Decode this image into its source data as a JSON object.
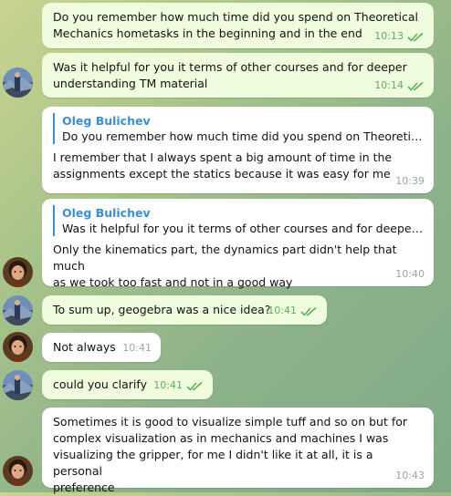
{
  "messages": [
    {
      "text": "Do you remember how much time did you spend on Theoretical\nMechanics hometasks in the beginning and in the end",
      "time": "10:13"
    },
    {
      "text": "Was it helpful for you it terms of other courses and for deeper\nunderstanding TM material",
      "time": "10:14"
    },
    {
      "reply_author": "Oleg Bulichev",
      "reply_text": "Do you remember how much time did you spend on Theoretical ...",
      "text": "I remember that I always spent a big amount of time in the\nassignments except the statics because it was easy for me",
      "time": "10:39"
    },
    {
      "reply_author": "Oleg Bulichev",
      "reply_text": "Was it helpful for you it terms of other courses and for deeper un...",
      "text": "Only the kinematics part, the dynamics part didn't help that much\nas we took too fast and not in a good way",
      "time": "10:40"
    },
    {
      "text": "To sum up, geogebra was a nice idea?",
      "time": "10:41"
    },
    {
      "text": "Not always",
      "time": "10:41"
    },
    {
      "text": "could you clarify",
      "time": "10:41"
    },
    {
      "text": "Sometimes it is good to visualize simple tuff and so on but for\ncomplex visualization as in mechanics and machines I was\nvisualizing the gripper, for me I didn't like it at all, it is a personal\npreference",
      "time": "10:43"
    }
  ],
  "colors": {
    "outgoing_bubble": "#effdde",
    "incoming_bubble": "#ffffff",
    "read_check": "#5fad5a",
    "reply_accent": "#3a8fd1"
  },
  "icons": {
    "avatar_sender": "avatar-landscape",
    "avatar_recipient": "avatar-portrait",
    "read_receipt": "double-check-icon"
  }
}
